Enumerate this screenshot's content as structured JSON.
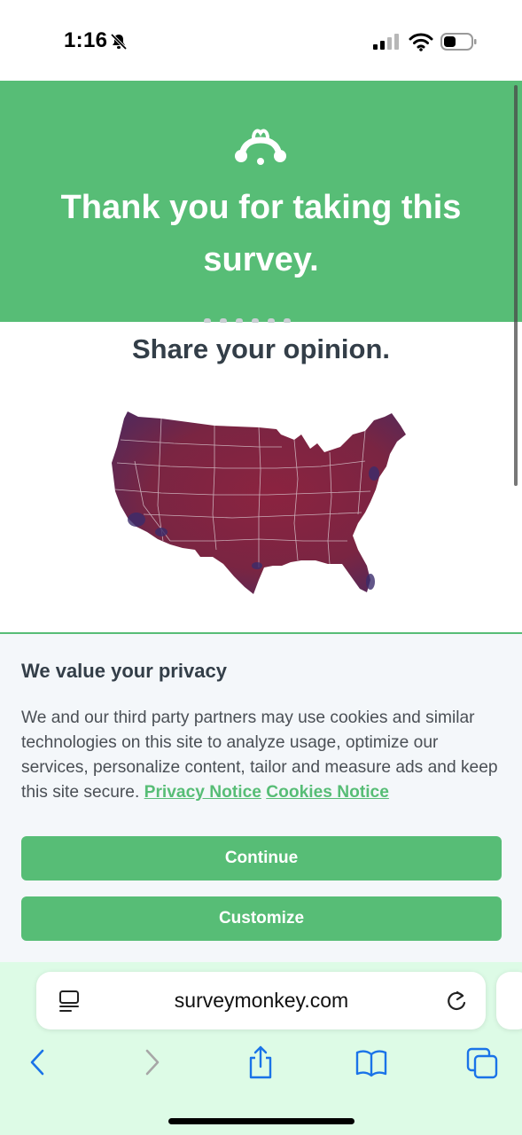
{
  "status_bar": {
    "time": "1:16"
  },
  "header": {
    "title": "Thank you for taking this survey."
  },
  "main": {
    "headline": "Share your opinion."
  },
  "privacy": {
    "heading": "We value your privacy",
    "body": "We and our third party partners may use cookies and similar technologies on this site to analyze usage, optimize our services, personalize content, tailor and measure ads and keep this site secure.",
    "privacy_link": "Privacy Notice",
    "cookies_link": "Cookies Notice",
    "continue_label": "Continue",
    "customize_label": "Customize"
  },
  "browser": {
    "url": "surveymonkey.com",
    "icons": [
      "reader-icon",
      "reload-icon",
      "back-icon",
      "forward-icon",
      "share-icon",
      "bookmarks-icon",
      "tabs-icon"
    ]
  },
  "colors": {
    "brand_green": "#57bd76",
    "text_dark": "#333e48",
    "toolbar_bg": "#ddfbe6",
    "ios_blue": "#1a73e8"
  }
}
